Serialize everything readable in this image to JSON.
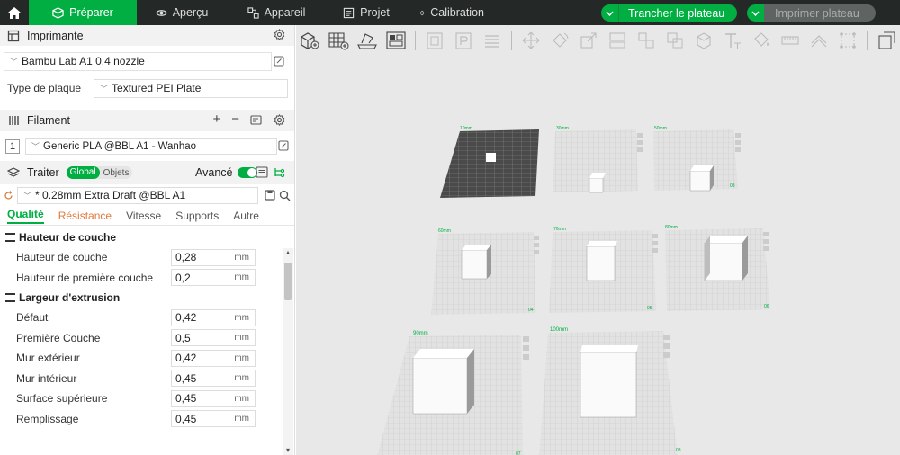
{
  "topbar": {
    "tabs": [
      {
        "label": "Préparer",
        "icon": "cube-icon"
      },
      {
        "label": "Aperçu",
        "icon": "eye-icon"
      },
      {
        "label": "Appareil",
        "icon": "device-icon"
      },
      {
        "label": "Projet",
        "icon": "project-icon"
      },
      {
        "label": "Calibration",
        "icon": "calibration-icon"
      }
    ],
    "slice_label": "Trancher le plateau",
    "print_label": "Imprimer plateau",
    "accent": "#00ae42",
    "bg": "#242928"
  },
  "printer": {
    "title": "Imprimante",
    "printer_name": "Bambu Lab A1 0.4 nozzle",
    "plate_label": "Type de plaque",
    "plate_value": "Textured PEI Plate"
  },
  "filament": {
    "title": "Filament",
    "slot": "1",
    "name": "Generic PLA @BBL A1 - Wanhao"
  },
  "process": {
    "title": "Traiter",
    "seg_global": "Global",
    "seg_objects": "Objets",
    "advanced_label": "Avancé",
    "preset": "* 0.28mm Extra Draft @BBL A1",
    "tabs": [
      "Qualité",
      "Résistance",
      "Vitesse",
      "Supports",
      "Autre"
    ],
    "groups": [
      {
        "title": "Hauteur de couche",
        "params": [
          {
            "label": "Hauteur de couche",
            "value": "0,28",
            "unit": "mm"
          },
          {
            "label": "Hauteur de première couche",
            "value": "0,2",
            "unit": "mm"
          }
        ]
      },
      {
        "title": "Largeur d'extrusion",
        "params": [
          {
            "label": "Défaut",
            "value": "0,42",
            "unit": "mm"
          },
          {
            "label": "Première Couche",
            "value": "0,5",
            "unit": "mm"
          },
          {
            "label": "Mur extérieur",
            "value": "0,42",
            "unit": "mm"
          },
          {
            "label": "Mur intérieur",
            "value": "0,45",
            "unit": "mm"
          },
          {
            "label": "Surface supérieure",
            "value": "0,45",
            "unit": "mm"
          },
          {
            "label": "Remplissage",
            "value": "0,45",
            "unit": "mm"
          }
        ]
      }
    ]
  },
  "scene": {
    "plates": [
      {
        "label": "10mm",
        "number": ""
      },
      {
        "label": "30mm",
        "number": ""
      },
      {
        "label": "50mm",
        "number": "03"
      },
      {
        "label": "60mm",
        "number": "04"
      },
      {
        "label": "70mm",
        "number": "05"
      },
      {
        "label": "80mm",
        "number": "06"
      },
      {
        "label": "90mm",
        "number": "07"
      },
      {
        "label": "100mm",
        "number": "08"
      }
    ]
  }
}
